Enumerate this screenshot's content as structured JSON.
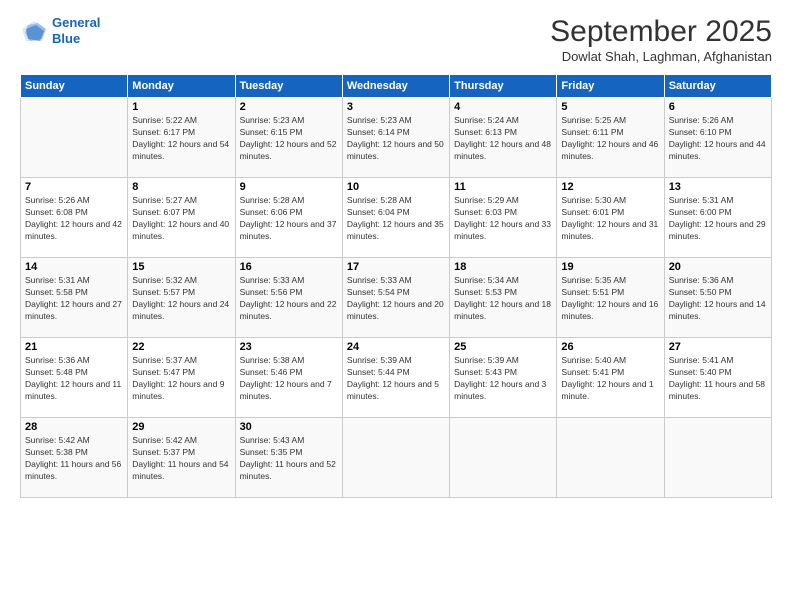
{
  "header": {
    "logo_line1": "General",
    "logo_line2": "Blue",
    "month": "September 2025",
    "location": "Dowlat Shah, Laghman, Afghanistan"
  },
  "days_of_week": [
    "Sunday",
    "Monday",
    "Tuesday",
    "Wednesday",
    "Thursday",
    "Friday",
    "Saturday"
  ],
  "weeks": [
    [
      {
        "day": "",
        "sunrise": "",
        "sunset": "",
        "daylight": ""
      },
      {
        "day": "1",
        "sunrise": "Sunrise: 5:22 AM",
        "sunset": "Sunset: 6:17 PM",
        "daylight": "Daylight: 12 hours and 54 minutes."
      },
      {
        "day": "2",
        "sunrise": "Sunrise: 5:23 AM",
        "sunset": "Sunset: 6:15 PM",
        "daylight": "Daylight: 12 hours and 52 minutes."
      },
      {
        "day": "3",
        "sunrise": "Sunrise: 5:23 AM",
        "sunset": "Sunset: 6:14 PM",
        "daylight": "Daylight: 12 hours and 50 minutes."
      },
      {
        "day": "4",
        "sunrise": "Sunrise: 5:24 AM",
        "sunset": "Sunset: 6:13 PM",
        "daylight": "Daylight: 12 hours and 48 minutes."
      },
      {
        "day": "5",
        "sunrise": "Sunrise: 5:25 AM",
        "sunset": "Sunset: 6:11 PM",
        "daylight": "Daylight: 12 hours and 46 minutes."
      },
      {
        "day": "6",
        "sunrise": "Sunrise: 5:26 AM",
        "sunset": "Sunset: 6:10 PM",
        "daylight": "Daylight: 12 hours and 44 minutes."
      }
    ],
    [
      {
        "day": "7",
        "sunrise": "Sunrise: 5:26 AM",
        "sunset": "Sunset: 6:08 PM",
        "daylight": "Daylight: 12 hours and 42 minutes."
      },
      {
        "day": "8",
        "sunrise": "Sunrise: 5:27 AM",
        "sunset": "Sunset: 6:07 PM",
        "daylight": "Daylight: 12 hours and 40 minutes."
      },
      {
        "day": "9",
        "sunrise": "Sunrise: 5:28 AM",
        "sunset": "Sunset: 6:06 PM",
        "daylight": "Daylight: 12 hours and 37 minutes."
      },
      {
        "day": "10",
        "sunrise": "Sunrise: 5:28 AM",
        "sunset": "Sunset: 6:04 PM",
        "daylight": "Daylight: 12 hours and 35 minutes."
      },
      {
        "day": "11",
        "sunrise": "Sunrise: 5:29 AM",
        "sunset": "Sunset: 6:03 PM",
        "daylight": "Daylight: 12 hours and 33 minutes."
      },
      {
        "day": "12",
        "sunrise": "Sunrise: 5:30 AM",
        "sunset": "Sunset: 6:01 PM",
        "daylight": "Daylight: 12 hours and 31 minutes."
      },
      {
        "day": "13",
        "sunrise": "Sunrise: 5:31 AM",
        "sunset": "Sunset: 6:00 PM",
        "daylight": "Daylight: 12 hours and 29 minutes."
      }
    ],
    [
      {
        "day": "14",
        "sunrise": "Sunrise: 5:31 AM",
        "sunset": "Sunset: 5:58 PM",
        "daylight": "Daylight: 12 hours and 27 minutes."
      },
      {
        "day": "15",
        "sunrise": "Sunrise: 5:32 AM",
        "sunset": "Sunset: 5:57 PM",
        "daylight": "Daylight: 12 hours and 24 minutes."
      },
      {
        "day": "16",
        "sunrise": "Sunrise: 5:33 AM",
        "sunset": "Sunset: 5:56 PM",
        "daylight": "Daylight: 12 hours and 22 minutes."
      },
      {
        "day": "17",
        "sunrise": "Sunrise: 5:33 AM",
        "sunset": "Sunset: 5:54 PM",
        "daylight": "Daylight: 12 hours and 20 minutes."
      },
      {
        "day": "18",
        "sunrise": "Sunrise: 5:34 AM",
        "sunset": "Sunset: 5:53 PM",
        "daylight": "Daylight: 12 hours and 18 minutes."
      },
      {
        "day": "19",
        "sunrise": "Sunrise: 5:35 AM",
        "sunset": "Sunset: 5:51 PM",
        "daylight": "Daylight: 12 hours and 16 minutes."
      },
      {
        "day": "20",
        "sunrise": "Sunrise: 5:36 AM",
        "sunset": "Sunset: 5:50 PM",
        "daylight": "Daylight: 12 hours and 14 minutes."
      }
    ],
    [
      {
        "day": "21",
        "sunrise": "Sunrise: 5:36 AM",
        "sunset": "Sunset: 5:48 PM",
        "daylight": "Daylight: 12 hours and 11 minutes."
      },
      {
        "day": "22",
        "sunrise": "Sunrise: 5:37 AM",
        "sunset": "Sunset: 5:47 PM",
        "daylight": "Daylight: 12 hours and 9 minutes."
      },
      {
        "day": "23",
        "sunrise": "Sunrise: 5:38 AM",
        "sunset": "Sunset: 5:46 PM",
        "daylight": "Daylight: 12 hours and 7 minutes."
      },
      {
        "day": "24",
        "sunrise": "Sunrise: 5:39 AM",
        "sunset": "Sunset: 5:44 PM",
        "daylight": "Daylight: 12 hours and 5 minutes."
      },
      {
        "day": "25",
        "sunrise": "Sunrise: 5:39 AM",
        "sunset": "Sunset: 5:43 PM",
        "daylight": "Daylight: 12 hours and 3 minutes."
      },
      {
        "day": "26",
        "sunrise": "Sunrise: 5:40 AM",
        "sunset": "Sunset: 5:41 PM",
        "daylight": "Daylight: 12 hours and 1 minute."
      },
      {
        "day": "27",
        "sunrise": "Sunrise: 5:41 AM",
        "sunset": "Sunset: 5:40 PM",
        "daylight": "Daylight: 11 hours and 58 minutes."
      }
    ],
    [
      {
        "day": "28",
        "sunrise": "Sunrise: 5:42 AM",
        "sunset": "Sunset: 5:38 PM",
        "daylight": "Daylight: 11 hours and 56 minutes."
      },
      {
        "day": "29",
        "sunrise": "Sunrise: 5:42 AM",
        "sunset": "Sunset: 5:37 PM",
        "daylight": "Daylight: 11 hours and 54 minutes."
      },
      {
        "day": "30",
        "sunrise": "Sunrise: 5:43 AM",
        "sunset": "Sunset: 5:35 PM",
        "daylight": "Daylight: 11 hours and 52 minutes."
      },
      {
        "day": "",
        "sunrise": "",
        "sunset": "",
        "daylight": ""
      },
      {
        "day": "",
        "sunrise": "",
        "sunset": "",
        "daylight": ""
      },
      {
        "day": "",
        "sunrise": "",
        "sunset": "",
        "daylight": ""
      },
      {
        "day": "",
        "sunrise": "",
        "sunset": "",
        "daylight": ""
      }
    ]
  ]
}
